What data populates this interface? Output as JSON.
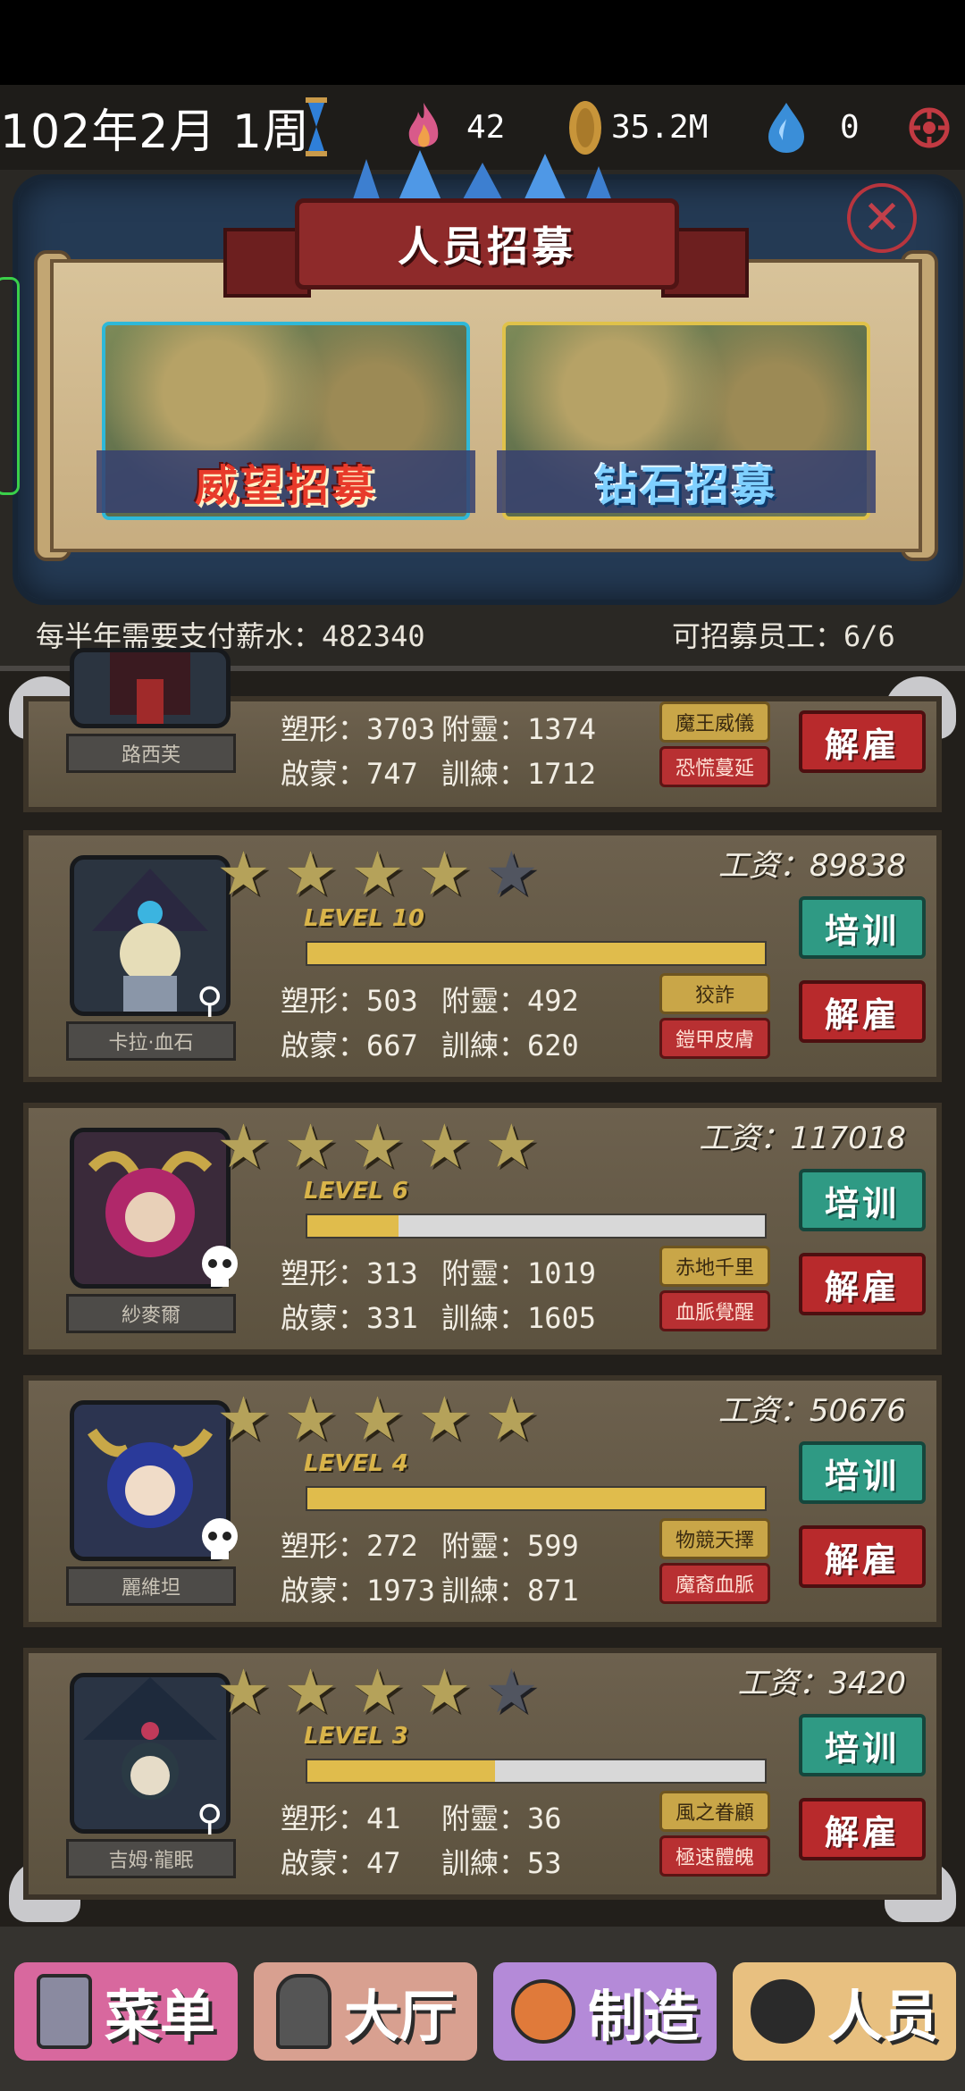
{
  "status": {
    "date": "102年2月 1周",
    "flame": "42",
    "coin": "35.2M",
    "drop": "0"
  },
  "recruit": {
    "title": "人员招募",
    "prestige_label": "威望招募",
    "diamond_label": "钻石招募",
    "salary_info": "每半年需要支付薪水：482340",
    "capacity_info": "可招募员工：6/6"
  },
  "staff": [
    {
      "name": "路西芙",
      "stats": {
        "shape": "塑形：3703",
        "attach": "附靈：1374",
        "enlighten": "啟蒙：747",
        "train": "訓練：1712"
      },
      "traits": [
        "魔王威儀",
        "恐慌蔓延"
      ],
      "fire_label": "解雇"
    },
    {
      "name": "卡拉·血石",
      "stars": 4,
      "level_label": "LEVEL",
      "level": "10",
      "level_progress": 1.0,
      "salary": "工资：89838",
      "stats": {
        "shape": "塑形：503",
        "attach": "附靈：492",
        "enlighten": "啟蒙：667",
        "train": "訓練：620"
      },
      "traits": [
        "狡詐",
        "鎧甲皮膚"
      ],
      "train_label": "培训",
      "fire_label": "解雇"
    },
    {
      "name": "紗麥爾",
      "stars": 5,
      "level_label": "LEVEL",
      "level": "6",
      "level_progress": 0.2,
      "salary": "工资：117018",
      "stats": {
        "shape": "塑形：313",
        "attach": "附靈：1019",
        "enlighten": "啟蒙：331",
        "train": "訓練：1605"
      },
      "traits": [
        "赤地千里",
        "血脈覺醒"
      ],
      "train_label": "培训",
      "fire_label": "解雇"
    },
    {
      "name": "麗維坦",
      "stars": 5,
      "level_label": "LEVEL",
      "level": "4",
      "level_progress": 1.0,
      "salary": "工资：50676",
      "stats": {
        "shape": "塑形：272",
        "attach": "附靈：599",
        "enlighten": "啟蒙：1973",
        "train": "訓練：871"
      },
      "traits": [
        "物競天擇",
        "魔裔血脈"
      ],
      "train_label": "培训",
      "fire_label": "解雇"
    },
    {
      "name": "吉姆·龍眠",
      "stars": 4,
      "level_label": "LEVEL",
      "level": "3",
      "level_progress": 0.41,
      "salary": "工资：3420",
      "stats": {
        "shape": "塑形：41",
        "attach": "附靈：36",
        "enlighten": "啟蒙：47",
        "train": "訓練：53"
      },
      "traits": [
        "風之眷顧",
        "極速體魄"
      ],
      "train_label": "培训",
      "fire_label": "解雇"
    }
  ],
  "nav": {
    "menu": "菜单",
    "hall": "大厅",
    "craft": "制造",
    "staff": "人员"
  },
  "colors": {
    "train_button": "#2f9a84",
    "fire_button": "#b82a2c",
    "trait_gold": "#c9a648",
    "trait_red": "#b83032",
    "level_fill": "#e0bc4c"
  }
}
